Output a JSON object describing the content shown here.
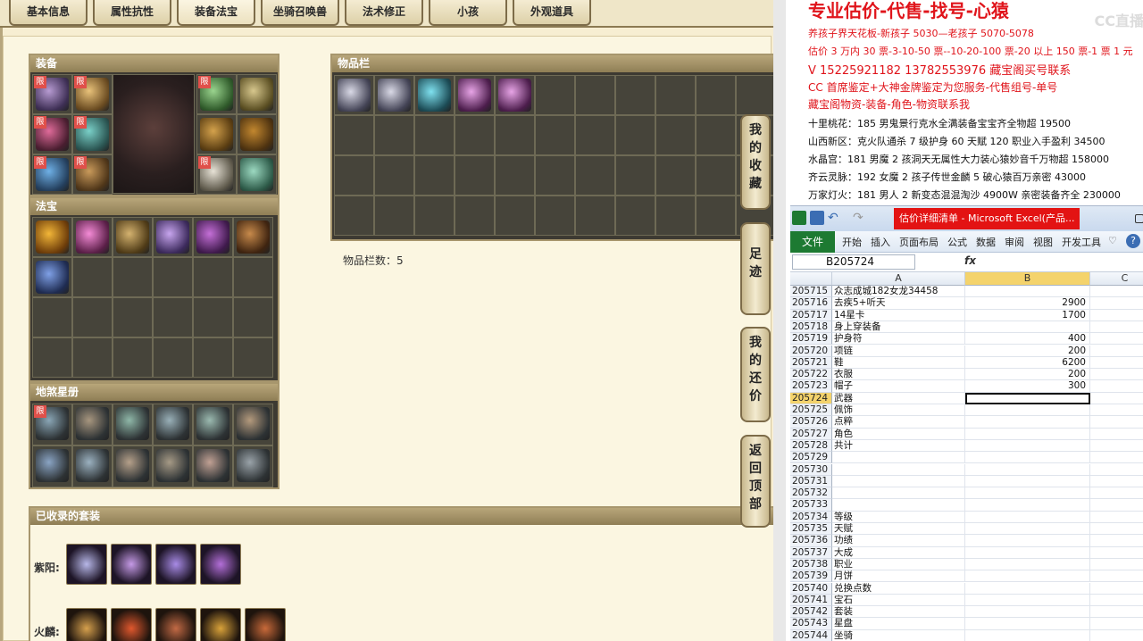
{
  "tabs": [
    "基本信息",
    "属性抗性",
    "装备法宝",
    "坐骑召唤兽",
    "法术修正",
    "小孩",
    "外观道具"
  ],
  "active_tab": "装备法宝",
  "sections": {
    "equipment": "装备",
    "inventory": "物品栏",
    "treasure": "法宝",
    "star_book": "地煞星册",
    "collected_sets": "已收录的套装"
  },
  "limit_tag": "限",
  "inventory_count": "物品栏数：5",
  "side_buttons": [
    [
      "我",
      "的",
      "收",
      "藏"
    ],
    [
      "足",
      "迹"
    ],
    [
      "我",
      "的",
      "还",
      "价"
    ],
    [
      "返",
      "回",
      "顶",
      "部"
    ]
  ],
  "set_rows": [
    "紫阳:",
    "火麟:"
  ],
  "notice": {
    "title": "专业估价-代售-找号-心猿",
    "lines_red": [
      "养孩子界天花板-新孩子 5030—老孩子 5070-5078",
      "估价 3 万内 30 票-3-10-50 票--10-20-100 票-20 以上 150 票-1 票 1 元",
      "V 15225921182       13782553976     藏宝阁买号联系",
      "CC 首席鉴定+大神金牌鉴定为您服务-代售组号-单号",
      "藏宝阁物资-装备-角色-物资联系我"
    ],
    "lines_black": [
      "十里桃花：185 男鬼景行克水全满装备宝宝齐全物超 19500",
      "山西新区：克火队通杀 7 级护身 60 天赋 120 职业入手盈利 34500",
      "水晶宫：181 男魔 2 孩洞天无属性大力装心猿妙音千万物超 158000",
      "齐云灵脉：192 女魔 2 孩子传世金麟 5 破心猿百万亲密 43000",
      "万家灯火：181 男人 2 新变态混混淘沙 4900W 亲密装备齐全 230000"
    ],
    "watermark": "CC直播"
  },
  "excel": {
    "doc_title": "估价详细清单 - Microsoft Excel(产品...",
    "file_tab": "文件",
    "menu": [
      "开始",
      "插入",
      "页面布局",
      "公式",
      "数据",
      "审阅",
      "视图",
      "开发工具"
    ],
    "name_box": "B205724",
    "fx": "fx",
    "col_heads": [
      "A",
      "B",
      "C"
    ],
    "rows": [
      {
        "r": "205715",
        "a": "众志成城182女龙34458",
        "b": ""
      },
      {
        "r": "205716",
        "a": "去疾5+听天",
        "b": "2900"
      },
      {
        "r": "205717",
        "a": "14星卡",
        "b": "1700"
      },
      {
        "r": "205718",
        "a": "身上穿装备",
        "b": ""
      },
      {
        "r": "205719",
        "a": "护身符",
        "b": "400"
      },
      {
        "r": "205720",
        "a": "项链",
        "b": "200"
      },
      {
        "r": "205721",
        "a": "鞋",
        "b": "6200"
      },
      {
        "r": "205722",
        "a": "衣服",
        "b": "200"
      },
      {
        "r": "205723",
        "a": "帽子",
        "b": "300"
      },
      {
        "r": "205724",
        "a": "武器",
        "b": ""
      },
      {
        "r": "205725",
        "a": "佩饰",
        "b": ""
      },
      {
        "r": "205726",
        "a": "点粹",
        "b": ""
      },
      {
        "r": "205727",
        "a": "角色",
        "b": ""
      },
      {
        "r": "205728",
        "a": "共计",
        "b": ""
      },
      {
        "r": "205729",
        "a": "",
        "b": ""
      },
      {
        "r": "205730",
        "a": "",
        "b": ""
      },
      {
        "r": "205731",
        "a": "",
        "b": ""
      },
      {
        "r": "205732",
        "a": "",
        "b": ""
      },
      {
        "r": "205733",
        "a": "",
        "b": ""
      },
      {
        "r": "205734",
        "a": "等级",
        "b": ""
      },
      {
        "r": "205735",
        "a": "天赋",
        "b": ""
      },
      {
        "r": "205736",
        "a": "功绩",
        "b": ""
      },
      {
        "r": "205737",
        "a": "大成",
        "b": ""
      },
      {
        "r": "205738",
        "a": "职业",
        "b": ""
      },
      {
        "r": "205739",
        "a": "月饼",
        "b": ""
      },
      {
        "r": "205740",
        "a": "兑换点数",
        "b": ""
      },
      {
        "r": "205741",
        "a": "宝石",
        "b": ""
      },
      {
        "r": "205742",
        "a": "套装",
        "b": ""
      },
      {
        "r": "205743",
        "a": "星盘",
        "b": ""
      },
      {
        "r": "205744",
        "a": "坐骑",
        "b": ""
      }
    ],
    "selected_row": "205724"
  },
  "colors": {
    "accent_red": "#e0141b",
    "excel_green": "#1d7a32",
    "limit_tag": "#e0504a"
  }
}
